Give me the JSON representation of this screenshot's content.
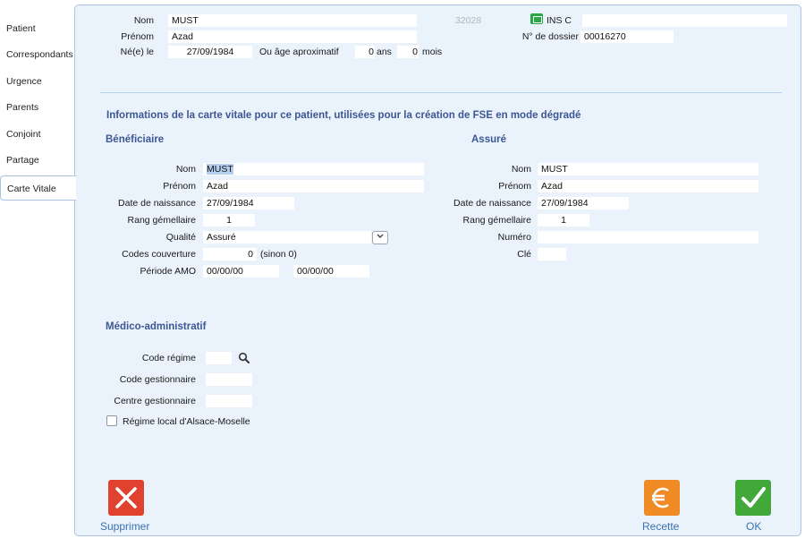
{
  "sidebar": {
    "items": [
      {
        "label": "Patient"
      },
      {
        "label": "Correspondants"
      },
      {
        "label": "Urgence"
      },
      {
        "label": "Parents"
      },
      {
        "label": "Conjoint"
      },
      {
        "label": "Partage"
      },
      {
        "label": "Carte Vitale",
        "active": true
      }
    ]
  },
  "header": {
    "nom_label": "Nom",
    "nom_value": "MUST",
    "prenom_label": "Prénom",
    "prenom_value": "Azad",
    "ne_label": "Né(e) le",
    "ne_value": "27/09/1984",
    "age_label": "Ou âge aproximatif",
    "age_years_value": "0",
    "age_years_unit": "ans",
    "age_months_value": "0",
    "age_months_unit": "mois",
    "id_number": "32028",
    "ins_label": "INS C",
    "ins_value": "",
    "dossier_label": "N° de dossier",
    "dossier_value": "00016270"
  },
  "carte_vitale": {
    "title": "Informations de la carte vitale pour ce patient, utilisées pour la création de FSE en mode dégradé",
    "beneficiaire": {
      "title": "Bénéficiaire",
      "nom_label": "Nom",
      "nom_value": "MUST",
      "prenom_label": "Prénom",
      "prenom_value": "Azad",
      "naissance_label": "Date de naissance",
      "naissance_value": "27/09/1984",
      "rang_label": "Rang gémellaire",
      "rang_value": "1",
      "qualite_label": "Qualité",
      "qualite_value": "Assuré",
      "codes_label": "Codes couverture",
      "codes_value": "0",
      "codes_hint": "(sinon 0)",
      "periode_label": "Période AMO",
      "periode_start": "00/00/00",
      "periode_end": "00/00/00"
    },
    "assure": {
      "title": "Assuré",
      "nom_label": "Nom",
      "nom_value": "MUST",
      "prenom_label": "Prénom",
      "prenom_value": "Azad",
      "naissance_label": "Date de naissance",
      "naissance_value": "27/09/1984",
      "rang_label": "Rang gémellaire",
      "rang_value": "1",
      "numero_label": "Numéro",
      "numero_value": "",
      "cle_label": "Clé",
      "cle_value": ""
    }
  },
  "medico": {
    "title": "Médico-administratif",
    "code_regime_label": "Code régime",
    "code_regime_value": "",
    "code_gestionnaire_label": "Code gestionnaire",
    "code_gestionnaire_value": "",
    "centre_gestionnaire_label": "Centre gestionnaire",
    "centre_gestionnaire_value": "",
    "alsace_label": "Régime local d'Alsace-Moselle",
    "alsace_checked": false
  },
  "actions": {
    "delete_label": "Supprimer",
    "recette_label": "Recette",
    "ok_label": "OK"
  },
  "icons": {
    "ins": "id-card-icon",
    "select": "chevron-down-icon",
    "search": "search-icon",
    "delete": "close-icon",
    "recette": "euro-icon",
    "ok": "checkmark-icon"
  },
  "colors": {
    "panel_bg": "#eaf2fb",
    "panel_border": "#a9c4e4",
    "section_title": "#3d5794",
    "link": "#3a72b3",
    "delete": "#e0422f",
    "recette": "#f08a24",
    "ok": "#42a83a",
    "ins": "#28a745"
  }
}
